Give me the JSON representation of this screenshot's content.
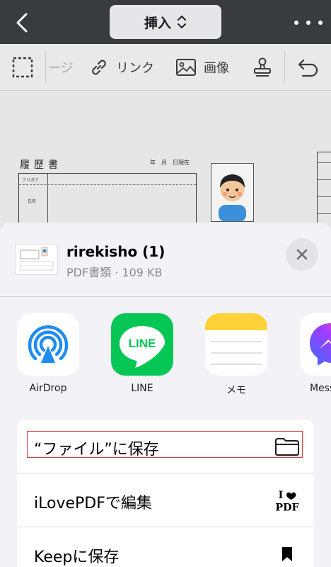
{
  "topbar": {
    "mode_label": "挿入",
    "back_icon": "chevron-left-icon",
    "more_icon": "ellipsis-icon"
  },
  "toolbar": {
    "partial_label": "ージ",
    "link_label": "リンク",
    "image_label": "画像"
  },
  "document": {
    "title": "履歴書",
    "date_text": "年　月　日現在",
    "furigana": "フリガナ",
    "name_label": "氏名"
  },
  "share": {
    "file_name": "rirekisho (1)",
    "file_meta": "PDF書類 · 109 KB",
    "apps": [
      {
        "label": "AirDrop",
        "icon": "airdrop-icon"
      },
      {
        "label": "LINE",
        "icon": "line-icon",
        "icon_text": "LINE"
      },
      {
        "label": "メモ",
        "icon": "notes-icon"
      },
      {
        "label": "Messe",
        "icon": "messenger-icon"
      }
    ],
    "actions": [
      {
        "label": "“ファイル”に保存",
        "icon": "folder-icon"
      },
      {
        "label": "iLovePDFで編集",
        "icon": "ilovepdf-icon",
        "icon_text": "PDF"
      },
      {
        "label": "Keepに保存",
        "icon": "bookmark-icon"
      }
    ]
  },
  "colors": {
    "topbar": "#3a3b3e",
    "line_green": "#06c755",
    "airdrop_blue": "#1f8cf0",
    "notes_yellow": "#ffd23a",
    "highlight_red": "#e03a3a"
  }
}
